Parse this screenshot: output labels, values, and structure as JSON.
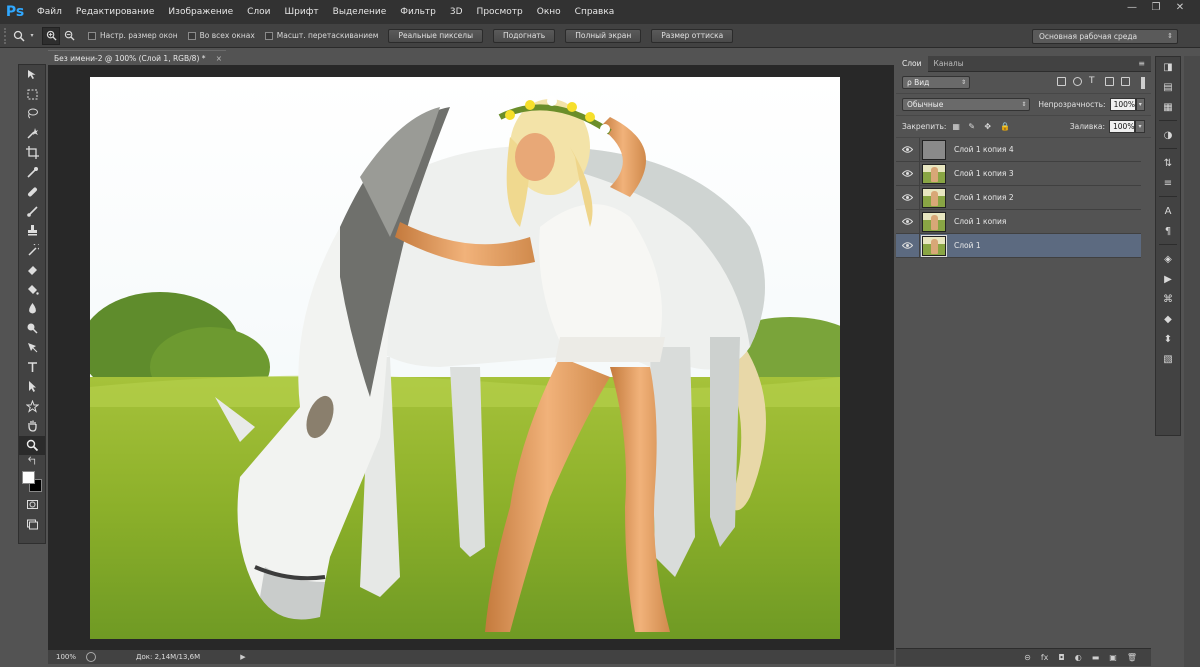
{
  "app": {
    "logo": "Ps"
  },
  "menu": [
    "Файл",
    "Редактирование",
    "Изображение",
    "Слои",
    "Шрифт",
    "Выделение",
    "Фильтр",
    "3D",
    "Просмотр",
    "Окно",
    "Справка"
  ],
  "window_controls": [
    "—",
    "❐",
    "✕"
  ],
  "options_bar": {
    "checkboxes": [
      "Настр. размер окон",
      "Во всех окнах",
      "Масшт. перетаскиванием"
    ],
    "buttons": [
      "Реальные пикселы",
      "Подогнать",
      "Полный экран",
      "Размер оттиска"
    ],
    "workspace": "Основная рабочая среда"
  },
  "document": {
    "tab_title": "Без имени-2 @ 100% (Слой 1, RGB/8) *",
    "close_glyph": "×"
  },
  "statusbar": {
    "zoom": "100%",
    "doc_info": "Док: 2,14M/13,6M",
    "play_glyph": "▶"
  },
  "layers_panel": {
    "tabs": [
      "Слои",
      "Каналы"
    ],
    "menu_glyph": "≡",
    "filter_kind": "ρ Вид",
    "blend_mode": "Обычные",
    "opacity_label": "Непрозрачность:",
    "opacity_value": "100%",
    "lock_label": "Закрепить:",
    "fill_label": "Заливка:",
    "fill_value": "100%",
    "layers": [
      {
        "name": "Слой 1 копия 4",
        "thumb": "gray",
        "selected": false
      },
      {
        "name": "Слой 1 копия 3",
        "thumb": "photo",
        "selected": false
      },
      {
        "name": "Слой 1 копия 2",
        "thumb": "photo",
        "selected": false
      },
      {
        "name": "Слой 1 копия",
        "thumb": "photo",
        "selected": false
      },
      {
        "name": "Слой 1",
        "thumb": "photo",
        "selected": true
      }
    ],
    "footer_icons": [
      "⊝",
      "fx",
      "◘",
      "◐",
      "▬",
      "▣",
      "🗑"
    ]
  },
  "icon_strip": [
    "◨",
    "▤",
    "▦",
    "◑",
    "⇅",
    "≡",
    "A",
    "¶",
    "◈",
    "▶",
    "⌘",
    "◆",
    "⬍",
    "▧"
  ],
  "colors": {
    "accent": "#30a8ff",
    "selected_layer": "#5c6a80"
  }
}
